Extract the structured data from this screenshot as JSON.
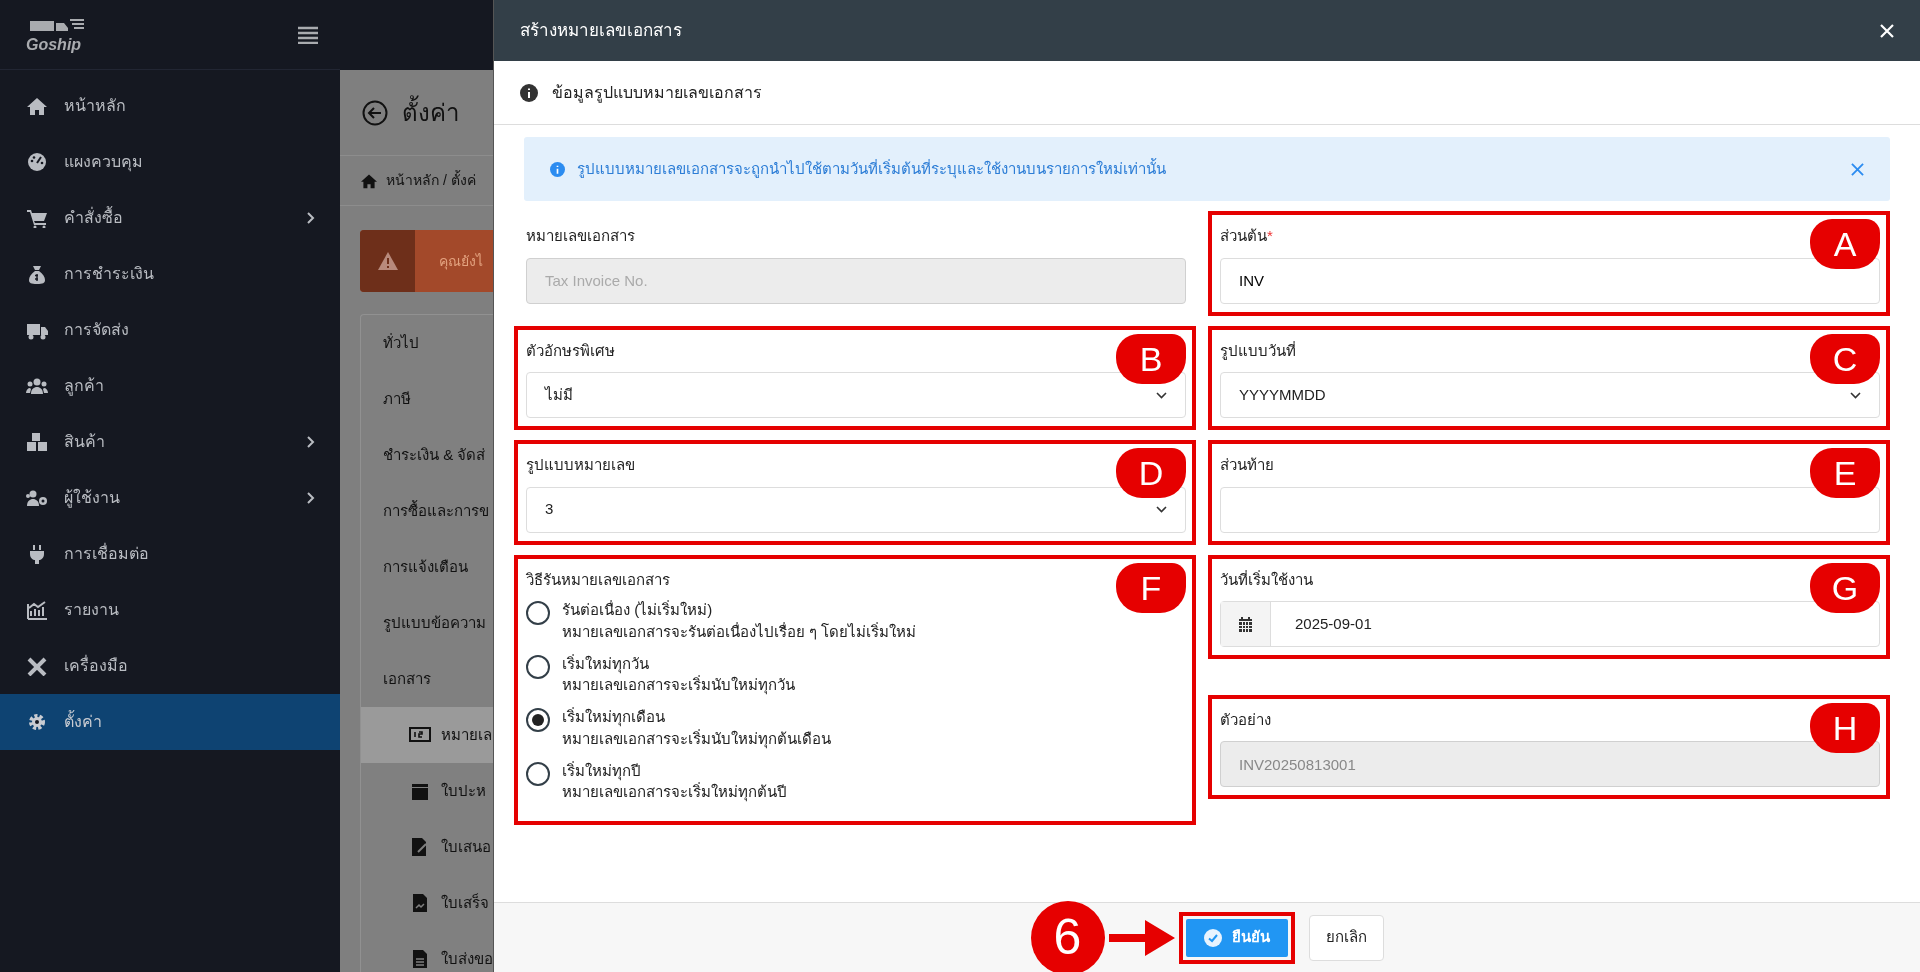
{
  "sidebar": {
    "logo": "Goship",
    "items": [
      {
        "label": "หน้าหลัก",
        "selected": false,
        "has_submenu": false
      },
      {
        "label": "แผงควบคุม",
        "selected": false,
        "has_submenu": false
      },
      {
        "label": "คำสั่งซื้อ",
        "selected": false,
        "has_submenu": true
      },
      {
        "label": "การชำระเงิน",
        "selected": false,
        "has_submenu": false
      },
      {
        "label": "การจัดส่ง",
        "selected": false,
        "has_submenu": false
      },
      {
        "label": "ลูกค้า",
        "selected": false,
        "has_submenu": false
      },
      {
        "label": "สินค้า",
        "selected": false,
        "has_submenu": true
      },
      {
        "label": "ผู้ใช้งาน",
        "selected": false,
        "has_submenu": true
      },
      {
        "label": "การเชื่อมต่อ",
        "selected": false,
        "has_submenu": false
      },
      {
        "label": "รายงาน",
        "selected": false,
        "has_submenu": false
      },
      {
        "label": "เครื่องมือ",
        "selected": false,
        "has_submenu": false
      },
      {
        "label": "ตั้งค่า",
        "selected": true,
        "has_submenu": false
      }
    ]
  },
  "page": {
    "title": "ตั้งค่า",
    "breadcrumb": "หน้าหลัก / ตั้งค่",
    "alert": "คุณยังไ",
    "menu": [
      {
        "label": "ทั่วไป"
      },
      {
        "label": "ภาษี"
      },
      {
        "label": "ชำระเงิน & จัดส่"
      },
      {
        "label": "การซื้อและการข"
      },
      {
        "label": "การแจ้งเตือน"
      },
      {
        "label": "รูปแบบข้อความ"
      },
      {
        "label": "เอกสาร",
        "children": [
          {
            "label": "หมายเล",
            "selected": true
          },
          {
            "label": "ใบปะห",
            "selected": false
          },
          {
            "label": "ใบเสนอ",
            "selected": false
          },
          {
            "label": "ใบเสร็จ",
            "selected": false
          },
          {
            "label": "ใบส่งขอ",
            "selected": false
          }
        ]
      }
    ]
  },
  "modal": {
    "title": "สร้างหมายเลขเอกสาร",
    "section_title": "ข้อมูลรูปแบบหมายเลขเอกสาร",
    "info": "รูปแบบหมายเลขเอกสารจะถูกนำไปใช้ตามวันที่เริ่มต้นที่ระบุและใช้งานบนรายการใหม่เท่านั้น",
    "fields": [
      {
        "kind": "input",
        "label": "หมายเลขเอกสาร",
        "placeholder": "Tax Invoice No.",
        "disabled": true
      },
      {
        "kind": "input",
        "label": "ส่วนต้น",
        "required_mark": "*",
        "value": "INV",
        "disabled": false,
        "marker": "A"
      },
      {
        "kind": "select",
        "label": "ตัวอักษรพิเศษ",
        "value": "ไม่มี",
        "marker": "B"
      },
      {
        "kind": "select",
        "label": "รูปแบบวันที่",
        "value": "YYYYMMDD",
        "marker": "C"
      },
      {
        "kind": "select",
        "label": "รูปแบบหมายเลข",
        "value": "3",
        "marker": "D"
      },
      {
        "kind": "input",
        "label": "ส่วนท้าย",
        "disabled": false,
        "marker": "E"
      },
      {
        "kind": "radio",
        "label": "วิธีรันหมายเลขเอกสาร",
        "marker": "F",
        "options": [
          {
            "title": "รันต่อเนื่อง (ไม่เริ่มใหม่)",
            "description": "หมายเลขเอกสารจะรันต่อเนื่องไปเรื่อย ๆ โดยไม่เริ่มใหม่",
            "selected": false
          },
          {
            "title": "เริ่มใหม่ทุกวัน",
            "description": "หมายเลขเอกสารจะเริ่มนับใหม่ทุกวัน",
            "selected": false
          },
          {
            "title": "เริ่มใหม่ทุกเดือน",
            "description": "หมายเลขเอกสารจะเริ่มนับใหม่ทุกต้นเดือน",
            "selected": true
          },
          {
            "title": "เริ่มใหม่ทุกปี",
            "description": "หมายเลขเอกสารจะเริ่มใหม่ทุกต้นปี",
            "selected": false
          }
        ]
      },
      {
        "kind": "date",
        "label": "วันที่เริ่มใช้งาน",
        "value": "2025-09-01",
        "marker": "G"
      },
      {
        "kind": "input",
        "label": "ตัวอย่าง",
        "value": "INV20250813001",
        "disabled": true,
        "marker": "H"
      }
    ],
    "buttons": [
      {
        "label": "ยืนยัน",
        "kind": "primary",
        "step": "6"
      },
      {
        "label": "ยกเลิก",
        "kind": "secondary"
      }
    ]
  }
}
